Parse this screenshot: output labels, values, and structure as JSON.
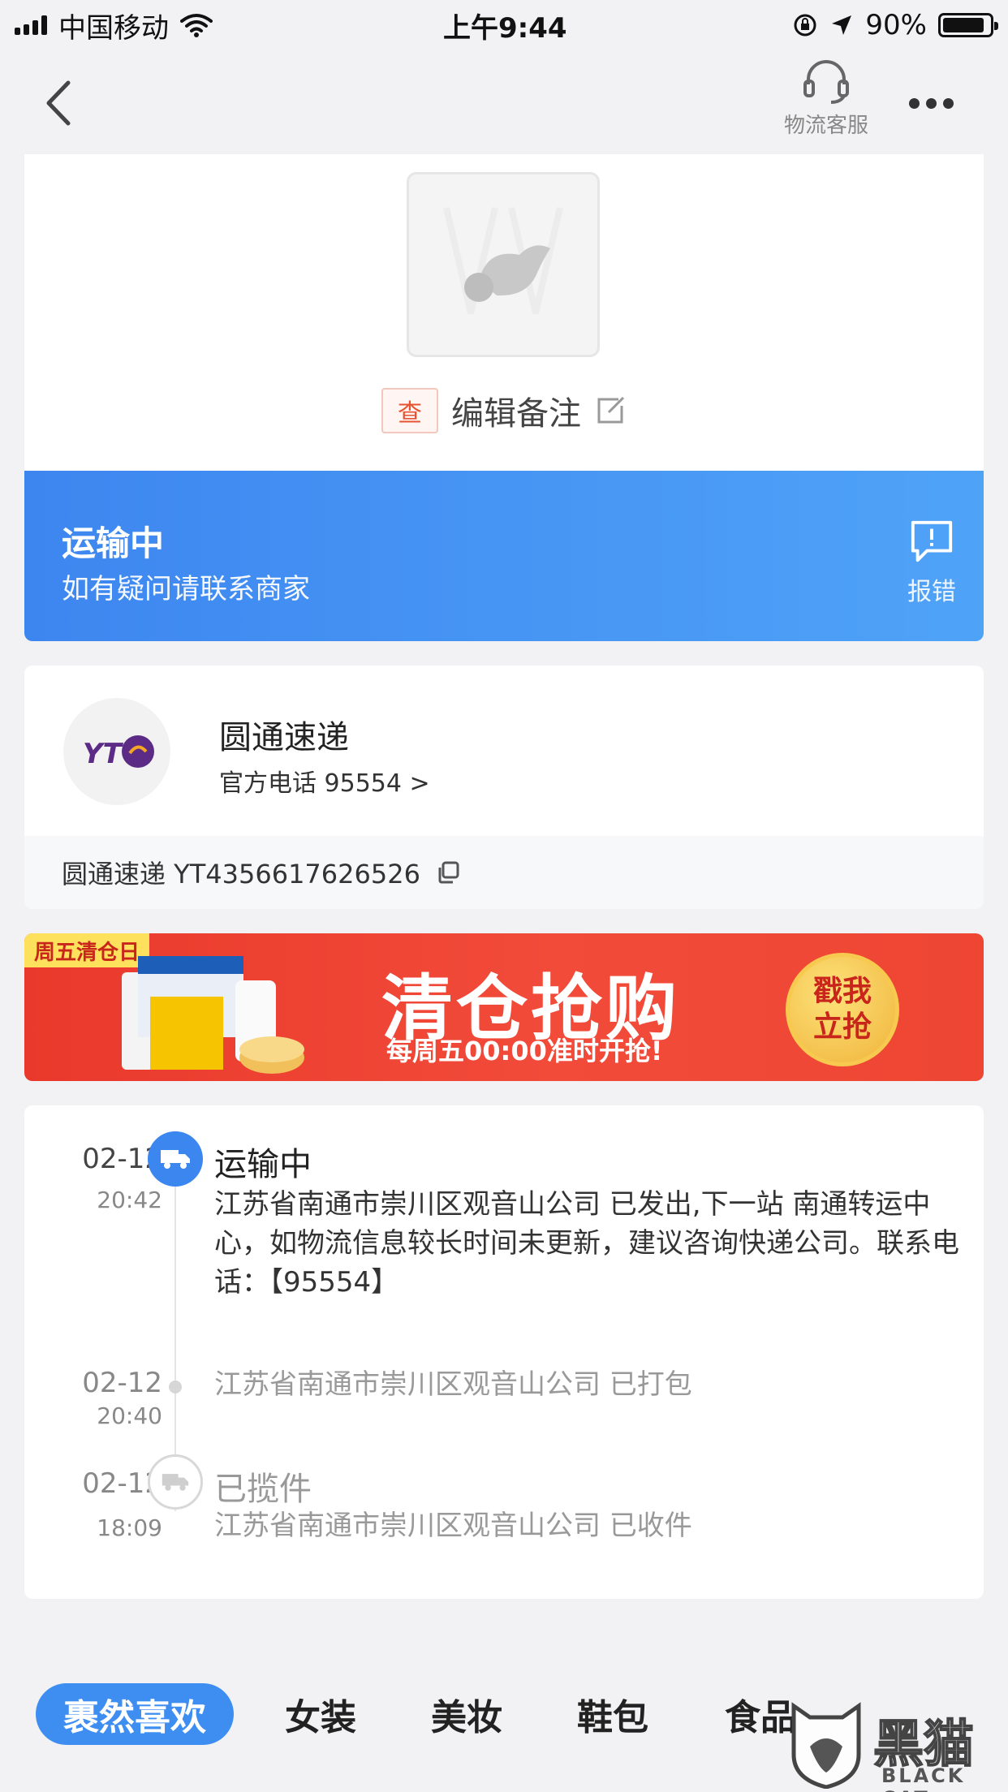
{
  "status_bar": {
    "carrier": "中国移动",
    "time": "上午9:44",
    "battery": "90%"
  },
  "nav": {
    "customer_service_label": "物流客服"
  },
  "product": {
    "check_tag": "查",
    "edit_note_label": "编辑备注"
  },
  "status_banner": {
    "title": "运输中",
    "subtitle": "如有疑问请联系商家",
    "report_label": "报错"
  },
  "courier": {
    "name": "圆通速递",
    "phone": "官方电话 95554 >",
    "tracking": "圆通速递 YT4356617626526"
  },
  "promo": {
    "tag": "周五清仓日",
    "title": "清仓抢购",
    "subtitle": "每周五00:00准时开抢!",
    "button_line1": "戳我",
    "button_line2": "立抢"
  },
  "timeline": [
    {
      "date": "02-12",
      "time": "20:42",
      "title": "运输中",
      "desc": "江苏省南通市崇川区观音山公司 已发出,下一站 南通转运中心，如物流信息较长时间未更新，建议咨询快递公司。联系电话：【95554】",
      "state": "active"
    },
    {
      "date": "02-12",
      "time": "20:40",
      "title": "",
      "desc": "江苏省南通市崇川区观音山公司 已打包",
      "state": "dot"
    },
    {
      "date": "02-12",
      "time": "18:09",
      "title": "已揽件",
      "desc": "江苏省南通市崇川区观音山公司 已收件",
      "state": "muted"
    }
  ],
  "tabs": [
    "裹然喜欢",
    "女装",
    "美妆",
    "鞋包",
    "食品"
  ],
  "watermark": {
    "text": "黑猫",
    "sub": "BLACK CAT"
  },
  "colors": {
    "accent_blue": "#3d86f0",
    "promo_red": "#e9392c",
    "check_red": "#e8532f"
  }
}
